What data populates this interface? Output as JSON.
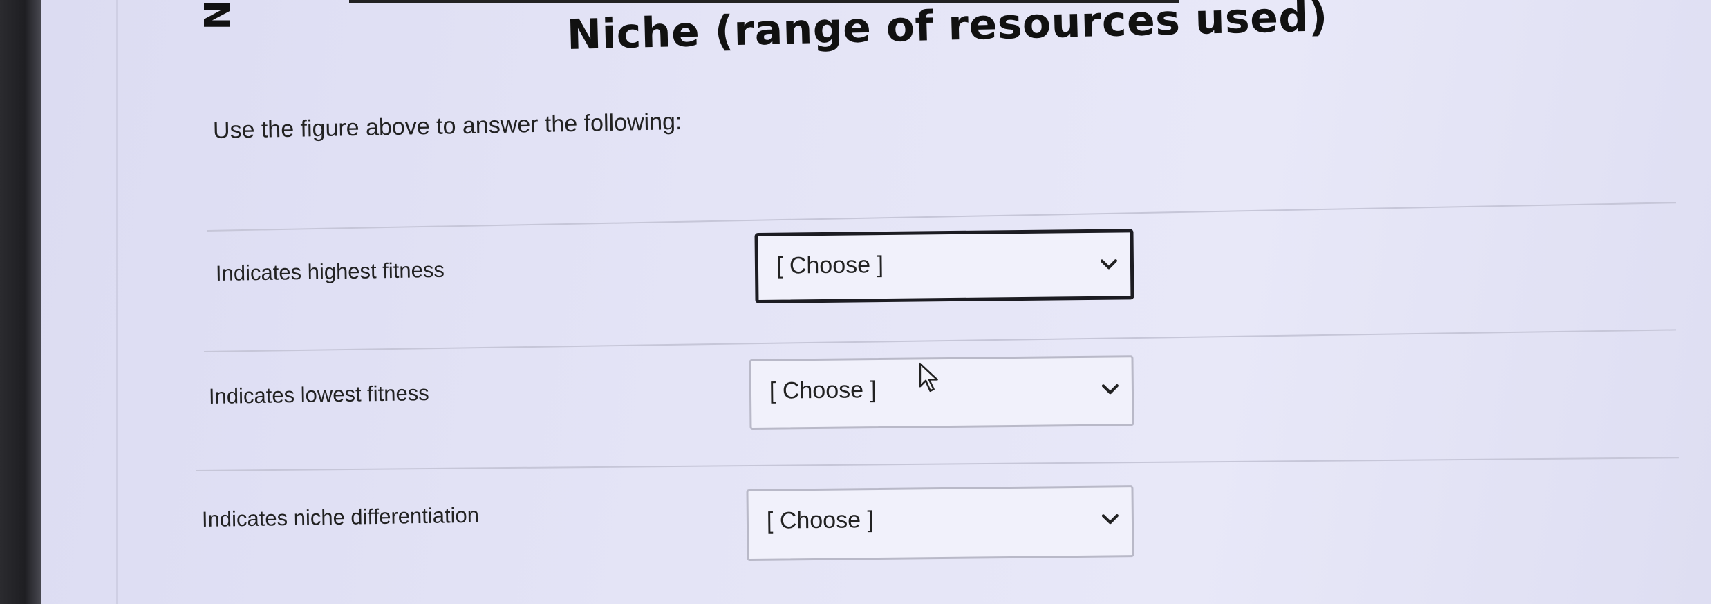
{
  "figure": {
    "title": "Niche (range of resources used)",
    "axis_fragment": "N"
  },
  "instructions": "Use the figure above to answer the following:",
  "questions": [
    {
      "label": "Indicates highest fitness",
      "selected": "[ Choose ]",
      "icon": "chevron-down-icon"
    },
    {
      "label": "Indicates lowest fitness",
      "selected": "[ Choose ]",
      "icon": "chevron-down-icon"
    },
    {
      "label": "Indicates niche differentiation",
      "selected": "[ Choose ]",
      "icon": "chevron-down-icon"
    }
  ],
  "colors": {
    "background": "#e4e4f6",
    "focus_border": "#1c1c22",
    "select_border": "#b9b9c8"
  }
}
